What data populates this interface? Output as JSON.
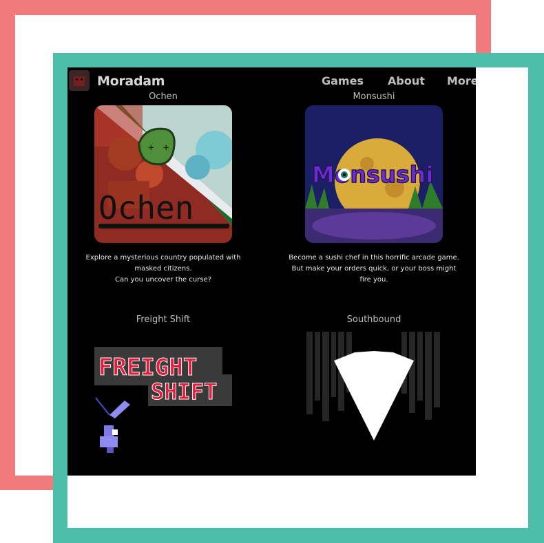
{
  "brand": {
    "title": "Moradam"
  },
  "nav": {
    "links": [
      "Games",
      "About",
      "More"
    ]
  },
  "games": [
    {
      "title": "Ochen",
      "art_text": "Ochen",
      "description": [
        "Explore a mysterious country populated with",
        "masked citizens.",
        "Can you uncover the curse?"
      ]
    },
    {
      "title": "Monsushi",
      "art_text": "Monsushi",
      "description": [
        "Become a sushi chef in this horrific arcade game.",
        "But make your orders quick, or your boss might",
        "fire you."
      ]
    },
    {
      "title": "Freight Shift",
      "art_text": [
        "FREIGHT",
        "SHIFT"
      ],
      "description": []
    },
    {
      "title": "Southbound",
      "description": []
    }
  ],
  "colors": {
    "frame_pink": "#f07b7d",
    "frame_teal": "#4bbfaa",
    "background": "#000000"
  }
}
